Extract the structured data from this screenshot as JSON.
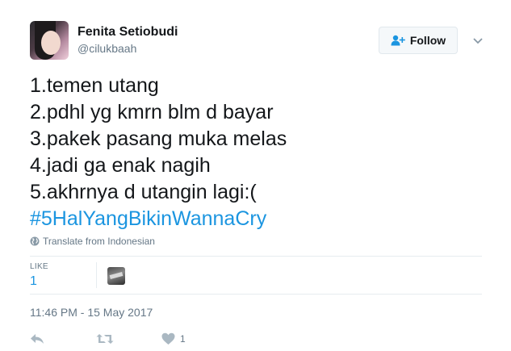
{
  "user": {
    "name": "Fenita Setiobudi",
    "handle": "@cilukbaah"
  },
  "follow_button": {
    "label": "Follow"
  },
  "tweet": {
    "lines": [
      "1.temen utang",
      "2.pdhl yg kmrn blm d bayar",
      "3.pakek pasang muka melas",
      "4.jadi ga enak nagih",
      "5.akhrnya d utangin lagi:("
    ],
    "hashtag": "#5HalYangBikinWannaCry"
  },
  "translate": {
    "label": "Translate from Indonesian"
  },
  "stats": {
    "like_label": "LIKE",
    "like_count": "1"
  },
  "timestamp": "11:46 PM - 15 May 2017",
  "actions": {
    "like_count": "1"
  },
  "colors": {
    "link": "#1b95e0",
    "text": "#14171a",
    "muted": "#657786",
    "divider": "#e6ecf0"
  },
  "icons": {
    "follow": "add-user-icon",
    "caret": "chevron-down-icon",
    "translate": "globe-icon",
    "reply": "reply-icon",
    "retweet": "retweet-icon",
    "like": "heart-icon"
  }
}
